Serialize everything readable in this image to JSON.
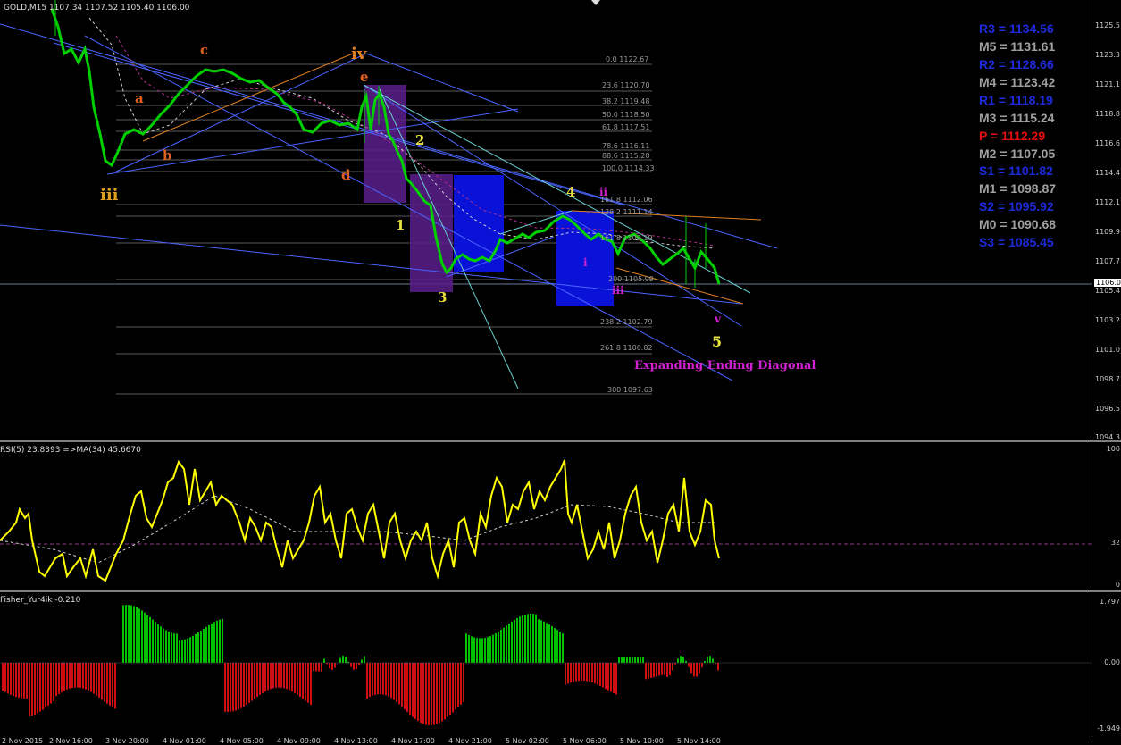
{
  "main_header": "GOLD,M15  1107.34 1107.52 1105.40 1106.00",
  "rsi_header": "RSI(5) 23.8393  =>MA(34) 45.6670",
  "fisher_header": "Fisher_Yur4ik -0.210",
  "pivots": [
    {
      "label": "R3 = 1134.56",
      "color": "#1d2bd6"
    },
    {
      "label": "M5 = 1131.61",
      "color": "#a0a0a0"
    },
    {
      "label": "R2 = 1128.66",
      "color": "#1d2bd6"
    },
    {
      "label": "M4 = 1123.42",
      "color": "#a0a0a0"
    },
    {
      "label": "R1 = 1118.19",
      "color": "#1d2bd6"
    },
    {
      "label": "M3 = 1115.24",
      "color": "#a0a0a0"
    },
    {
      "label": "P  = 1112.29",
      "color": "#e01010"
    },
    {
      "label": "M2 = 1107.05",
      "color": "#a0a0a0"
    },
    {
      "label": "S1 = 1101.82",
      "color": "#1d2bd6"
    },
    {
      "label": "M1 = 1098.87",
      "color": "#a0a0a0"
    },
    {
      "label": "S2 = 1095.92",
      "color": "#1d2bd6"
    },
    {
      "label": "M0 = 1090.68",
      "color": "#a0a0a0"
    },
    {
      "label": "S3 = 1085.45",
      "color": "#1d2bd6"
    }
  ],
  "fib_levels": [
    "0.0  1122.67",
    "23.6  1120.70",
    "38.2  1119.48",
    "50.0  1118.50",
    "61.8  1117.51",
    "78.6  1116.11",
    "88.6  1115.28",
    "100.0  1114.33",
    "161.8  1112.06",
    "138.2  1111.14",
    "161.8  1109.19",
    "200  1105.99",
    "238.2  1102.79",
    "261.8  1100.82",
    "300  1097.63"
  ],
  "wave_labels": {
    "iii": "iii",
    "iv": "iv",
    "a": "a",
    "b": "b",
    "c": "c",
    "d": "d",
    "e": "e",
    "w1": "1",
    "w2": "2",
    "w3": "3",
    "w4": "4",
    "w5": "5",
    "mi": "i",
    "mii": "ii",
    "miii": "iii",
    "mv": "v"
  },
  "annotation": "Expanding Ending Diagonal",
  "price_ticks": [
    "1125.5",
    "1123.3",
    "1121.1",
    "1118.8",
    "1116.6",
    "1114.4",
    "1112.1",
    "1109.9",
    "1107.7",
    "1105.4",
    "1103.2",
    "1101.0",
    "1098.7",
    "1096.5",
    "1094.3"
  ],
  "current_price": "1106.0",
  "rsi_ticks": [
    "100",
    "32",
    "0"
  ],
  "fisher_ticks": [
    "1.797",
    "0.00",
    "-1.949"
  ],
  "time_labels": [
    "2 Nov 2015",
    "2 Nov 16:00",
    "3 Nov 20:00",
    "4 Nov 01:00",
    "4 Nov 05:00",
    "4 Nov 09:00",
    "4 Nov 13:00",
    "4 Nov 17:00",
    "4 Nov 21:00",
    "5 Nov 02:00",
    "5 Nov 06:00",
    "5 Nov 10:00",
    "5 Nov 14:00"
  ],
  "colors": {
    "bull": "#00c000",
    "bear": "#d01010",
    "rsi": "#ffff00",
    "candle": "#00d000",
    "trend": "#4060ff",
    "fib": "#707070"
  }
}
